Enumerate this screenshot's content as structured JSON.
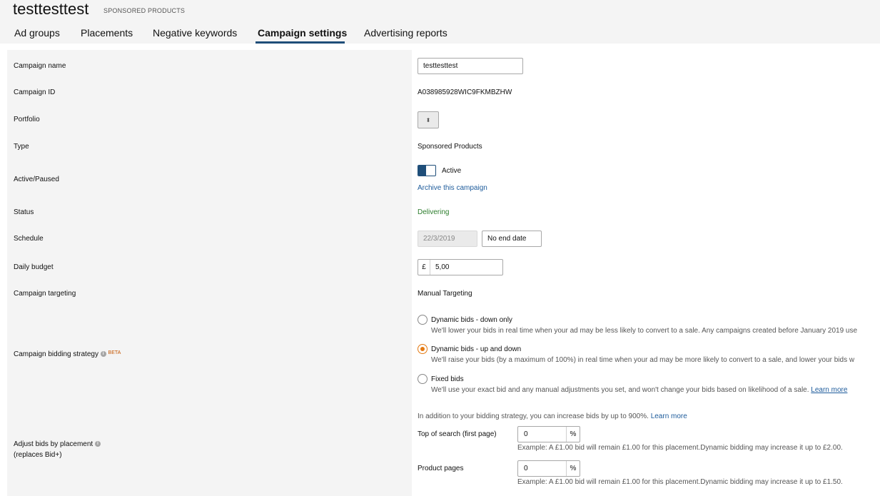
{
  "header": {
    "title": "testtesttest",
    "subtitle": "SPONSORED PRODUCTS"
  },
  "tabs": [
    {
      "label": "Ad groups"
    },
    {
      "label": "Placements"
    },
    {
      "label": "Negative keywords"
    },
    {
      "label": "Campaign settings",
      "active": true
    },
    {
      "label": "Advertising reports"
    }
  ],
  "rows": {
    "campaign_name": {
      "label": "Campaign name",
      "value": "testtesttest"
    },
    "campaign_id": {
      "label": "Campaign ID",
      "value": "A038985928WIC9FKMBZHW"
    },
    "portfolio": {
      "label": "Portfolio",
      "value": ""
    },
    "type": {
      "label": "Type",
      "value": "Sponsored Products"
    },
    "active_paused": {
      "label": "Active/Paused",
      "toggle_label": "Active",
      "archive_link": "Archive this campaign"
    },
    "status": {
      "label": "Status",
      "value": "Delivering"
    },
    "schedule": {
      "label": "Schedule",
      "start_date": "22/3/2019",
      "end_date": "No end date"
    },
    "daily_budget": {
      "label": "Daily budget",
      "currency": "£",
      "value": "5,00"
    },
    "campaign_targeting": {
      "label": "Campaign targeting",
      "value": "Manual Targeting"
    },
    "bidding_strategy": {
      "label": "Campaign bidding strategy",
      "badge": "BETA",
      "options": [
        {
          "title": "Dynamic bids - down only",
          "desc": "We'll lower your bids in real time when your ad may be less likely to convert to a sale. Any campaigns created before January 2019 use"
        },
        {
          "title": "Dynamic bids - up and down",
          "desc": "We'll raise your bids (by a maximum of 100%) in real time when your ad may be more likely to convert to a sale, and lower your bids w",
          "selected": true
        },
        {
          "title": "Fixed bids",
          "desc": "We'll use your exact bid and any manual adjustments you set, and won't change your bids based on likelihood of a sale.",
          "link": "Learn more"
        }
      ]
    },
    "adjust_bids": {
      "label": "Adjust bids by placement",
      "sublabel": "(replaces Bid+)",
      "intro": "In addition to your bidding strategy, you can increase bids by up to 900%.",
      "intro_link": "Learn more",
      "placements": [
        {
          "label": "Top of search (first page)",
          "value": "0",
          "unit": "%",
          "example": "Example: A £1.00 bid will remain £1.00 for this placement.Dynamic bidding may increase it up to £2.00."
        },
        {
          "label": "Product pages",
          "value": "0",
          "unit": "%",
          "example": "Example: A £1.00 bid will remain £1.00 for this placement.Dynamic bidding may increase it up to £1.50."
        }
      ]
    }
  },
  "icons": {
    "info": "info-icon",
    "portfolio_select": "up-down-caret-icon"
  },
  "colors": {
    "accent": "#1f4e79",
    "link": "#1d5b9b",
    "status": "#2c7d2c",
    "radio_selected": "#e47911",
    "beta": "#c45500"
  }
}
